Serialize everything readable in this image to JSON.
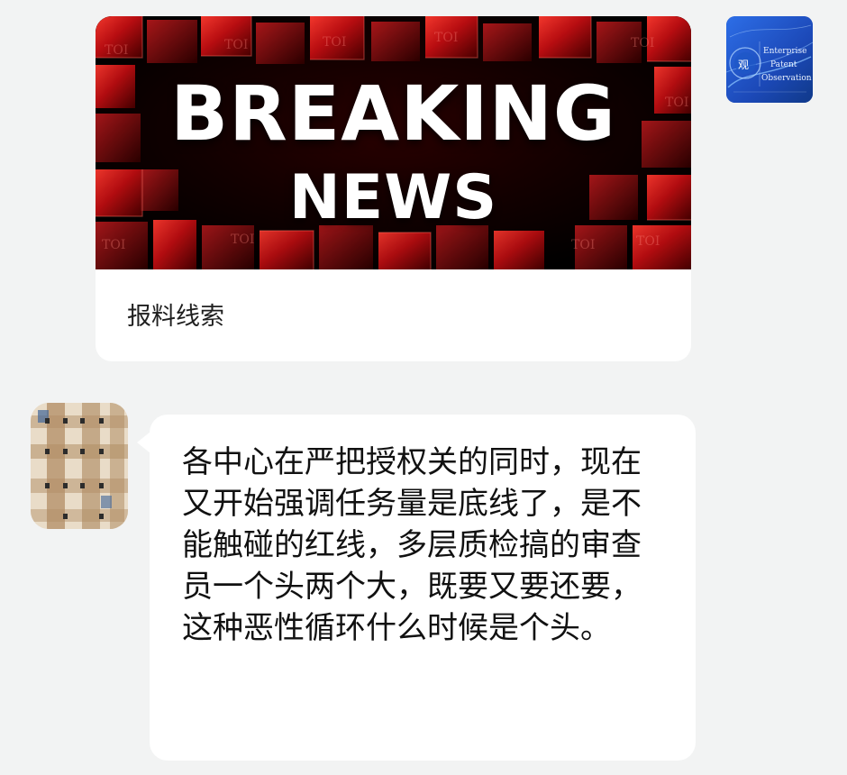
{
  "article_card": {
    "banner": {
      "line_1": "BREAKING",
      "line_2": "NEWS",
      "watermark": "TOI",
      "colors": {
        "dark": "#100000",
        "red": "#c10e12",
        "highlight": "#ff3a2f",
        "text": "#ffffff"
      }
    },
    "title": "报料线索"
  },
  "official_avatar": {
    "char": "观",
    "line_1": "Enterprise",
    "line_2": "Patent",
    "line_3": "Observation",
    "color": "#1c49b8"
  },
  "message": {
    "text": "各中心在严把授权关的同时，现在又开始强调任务量是底线了，是不能触碰的红线，多层质检搞的审查员一个头两个大，既要又要还要，这种恶性循环什么时候是个头。"
  },
  "user_avatar": {
    "pixelated": true,
    "colors": {
      "beige": "#e9dcc8",
      "tan": "#b18e65",
      "dark": "#2c2c2c",
      "blue": "#4b6d9b"
    }
  }
}
